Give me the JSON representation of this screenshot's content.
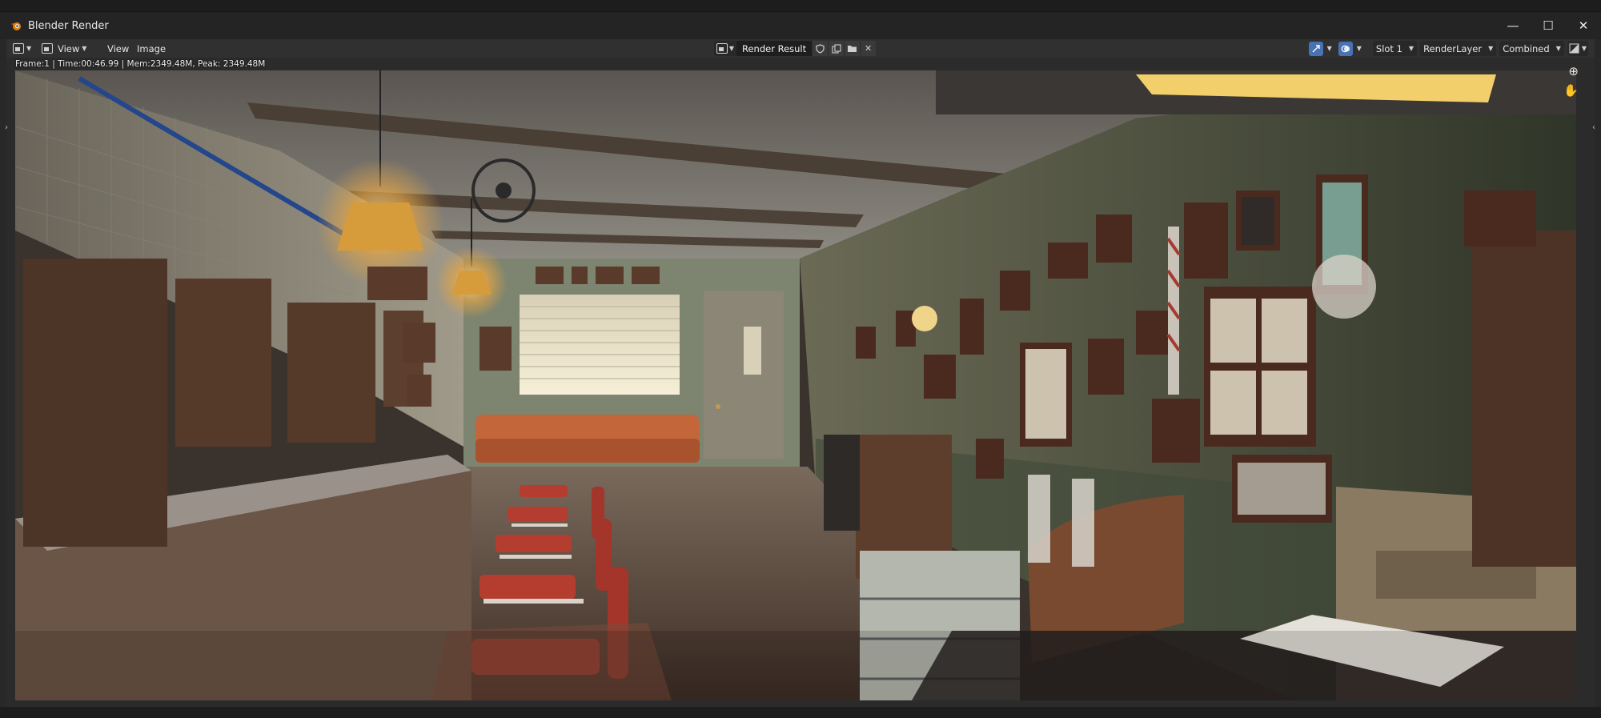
{
  "window": {
    "title": "Blender Render",
    "controls": {
      "minimize": "—",
      "maximize": "☐",
      "close": "✕"
    }
  },
  "header": {
    "view_dropdown_label": "View",
    "menus": [
      "View",
      "Image"
    ],
    "image_name": "Render Result",
    "slot": "Slot 1",
    "render_layer": "RenderLayer",
    "pass": "Combined"
  },
  "viewport": {
    "stats": "Frame:1 | Time:00:46.99 | Mem:2349.48M, Peak: 2349.48M",
    "zoom_icon_glyph": "⊕",
    "pan_icon_glyph": "✋"
  },
  "colors": {
    "accent": "#4772b3",
    "ui_dark": "#242424",
    "ui_header": "#303030"
  },
  "icons": [
    "blender-logo-icon",
    "image-editor-icon",
    "fake-user-shield-icon",
    "duplicate-icon",
    "folder-icon",
    "close-icon",
    "gizmo-icon",
    "overlay-icon",
    "display-channels-icon",
    "zoom-icon",
    "pan-hand-icon"
  ]
}
